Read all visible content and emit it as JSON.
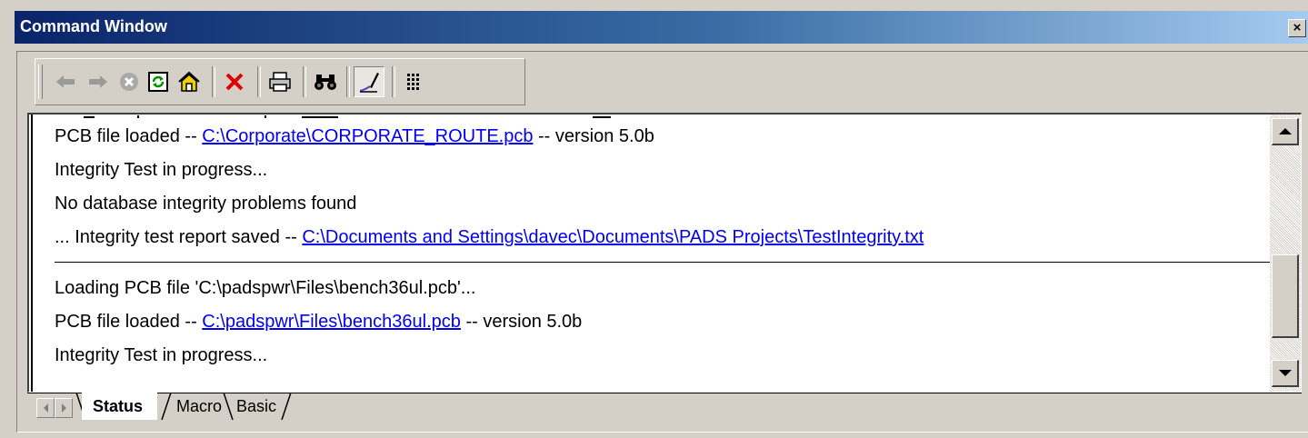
{
  "window": {
    "title": "Command Window",
    "close_label": "×"
  },
  "toolbar": {
    "buttons": [
      {
        "name": "back",
        "icon": "arrow-left-icon"
      },
      {
        "name": "forward",
        "icon": "arrow-right-icon"
      },
      {
        "name": "stop",
        "icon": "stop-icon"
      },
      {
        "name": "refresh",
        "icon": "refresh-icon"
      },
      {
        "name": "home",
        "icon": "home-icon"
      },
      {
        "name": "delete",
        "icon": "delete-x-icon"
      },
      {
        "name": "print",
        "icon": "printer-icon"
      },
      {
        "name": "find",
        "icon": "binoculars-icon"
      },
      {
        "name": "format",
        "icon": "pen-icon"
      },
      {
        "name": "layout",
        "icon": "grid-icon"
      }
    ],
    "colors": {
      "delete": "#e00000",
      "refresh": "#00a000",
      "home": "#c08000",
      "pen": "#6040c0"
    }
  },
  "log": {
    "lines": [
      {
        "prefix": "PCB file loaded -- ",
        "link": "C:\\Corporate\\CORPORATE_ROUTE.pcb",
        "suffix": " -- version 5.0b"
      },
      {
        "text": "Integrity Test in progress..."
      },
      {
        "text": "No database integrity problems found"
      },
      {
        "prefix": "... Integrity test report saved -- ",
        "link": "C:\\Documents and Settings\\davec\\Documents\\PADS Projects\\TestIntegrity.txt",
        "suffix": ""
      },
      {
        "text": "Loading PCB file 'C:\\padspwr\\Files\\bench36ul.pcb'..."
      },
      {
        "prefix": "PCB file loaded -- ",
        "link": "C:\\padspwr\\Files\\bench36ul.pcb",
        "suffix": " -- version 5.0b"
      },
      {
        "text": "Integrity Test in progress..."
      }
    ]
  },
  "tabs": [
    {
      "label": "Status",
      "active": true
    },
    {
      "label": "Macro",
      "active": false
    },
    {
      "label": "Basic",
      "active": false
    }
  ]
}
